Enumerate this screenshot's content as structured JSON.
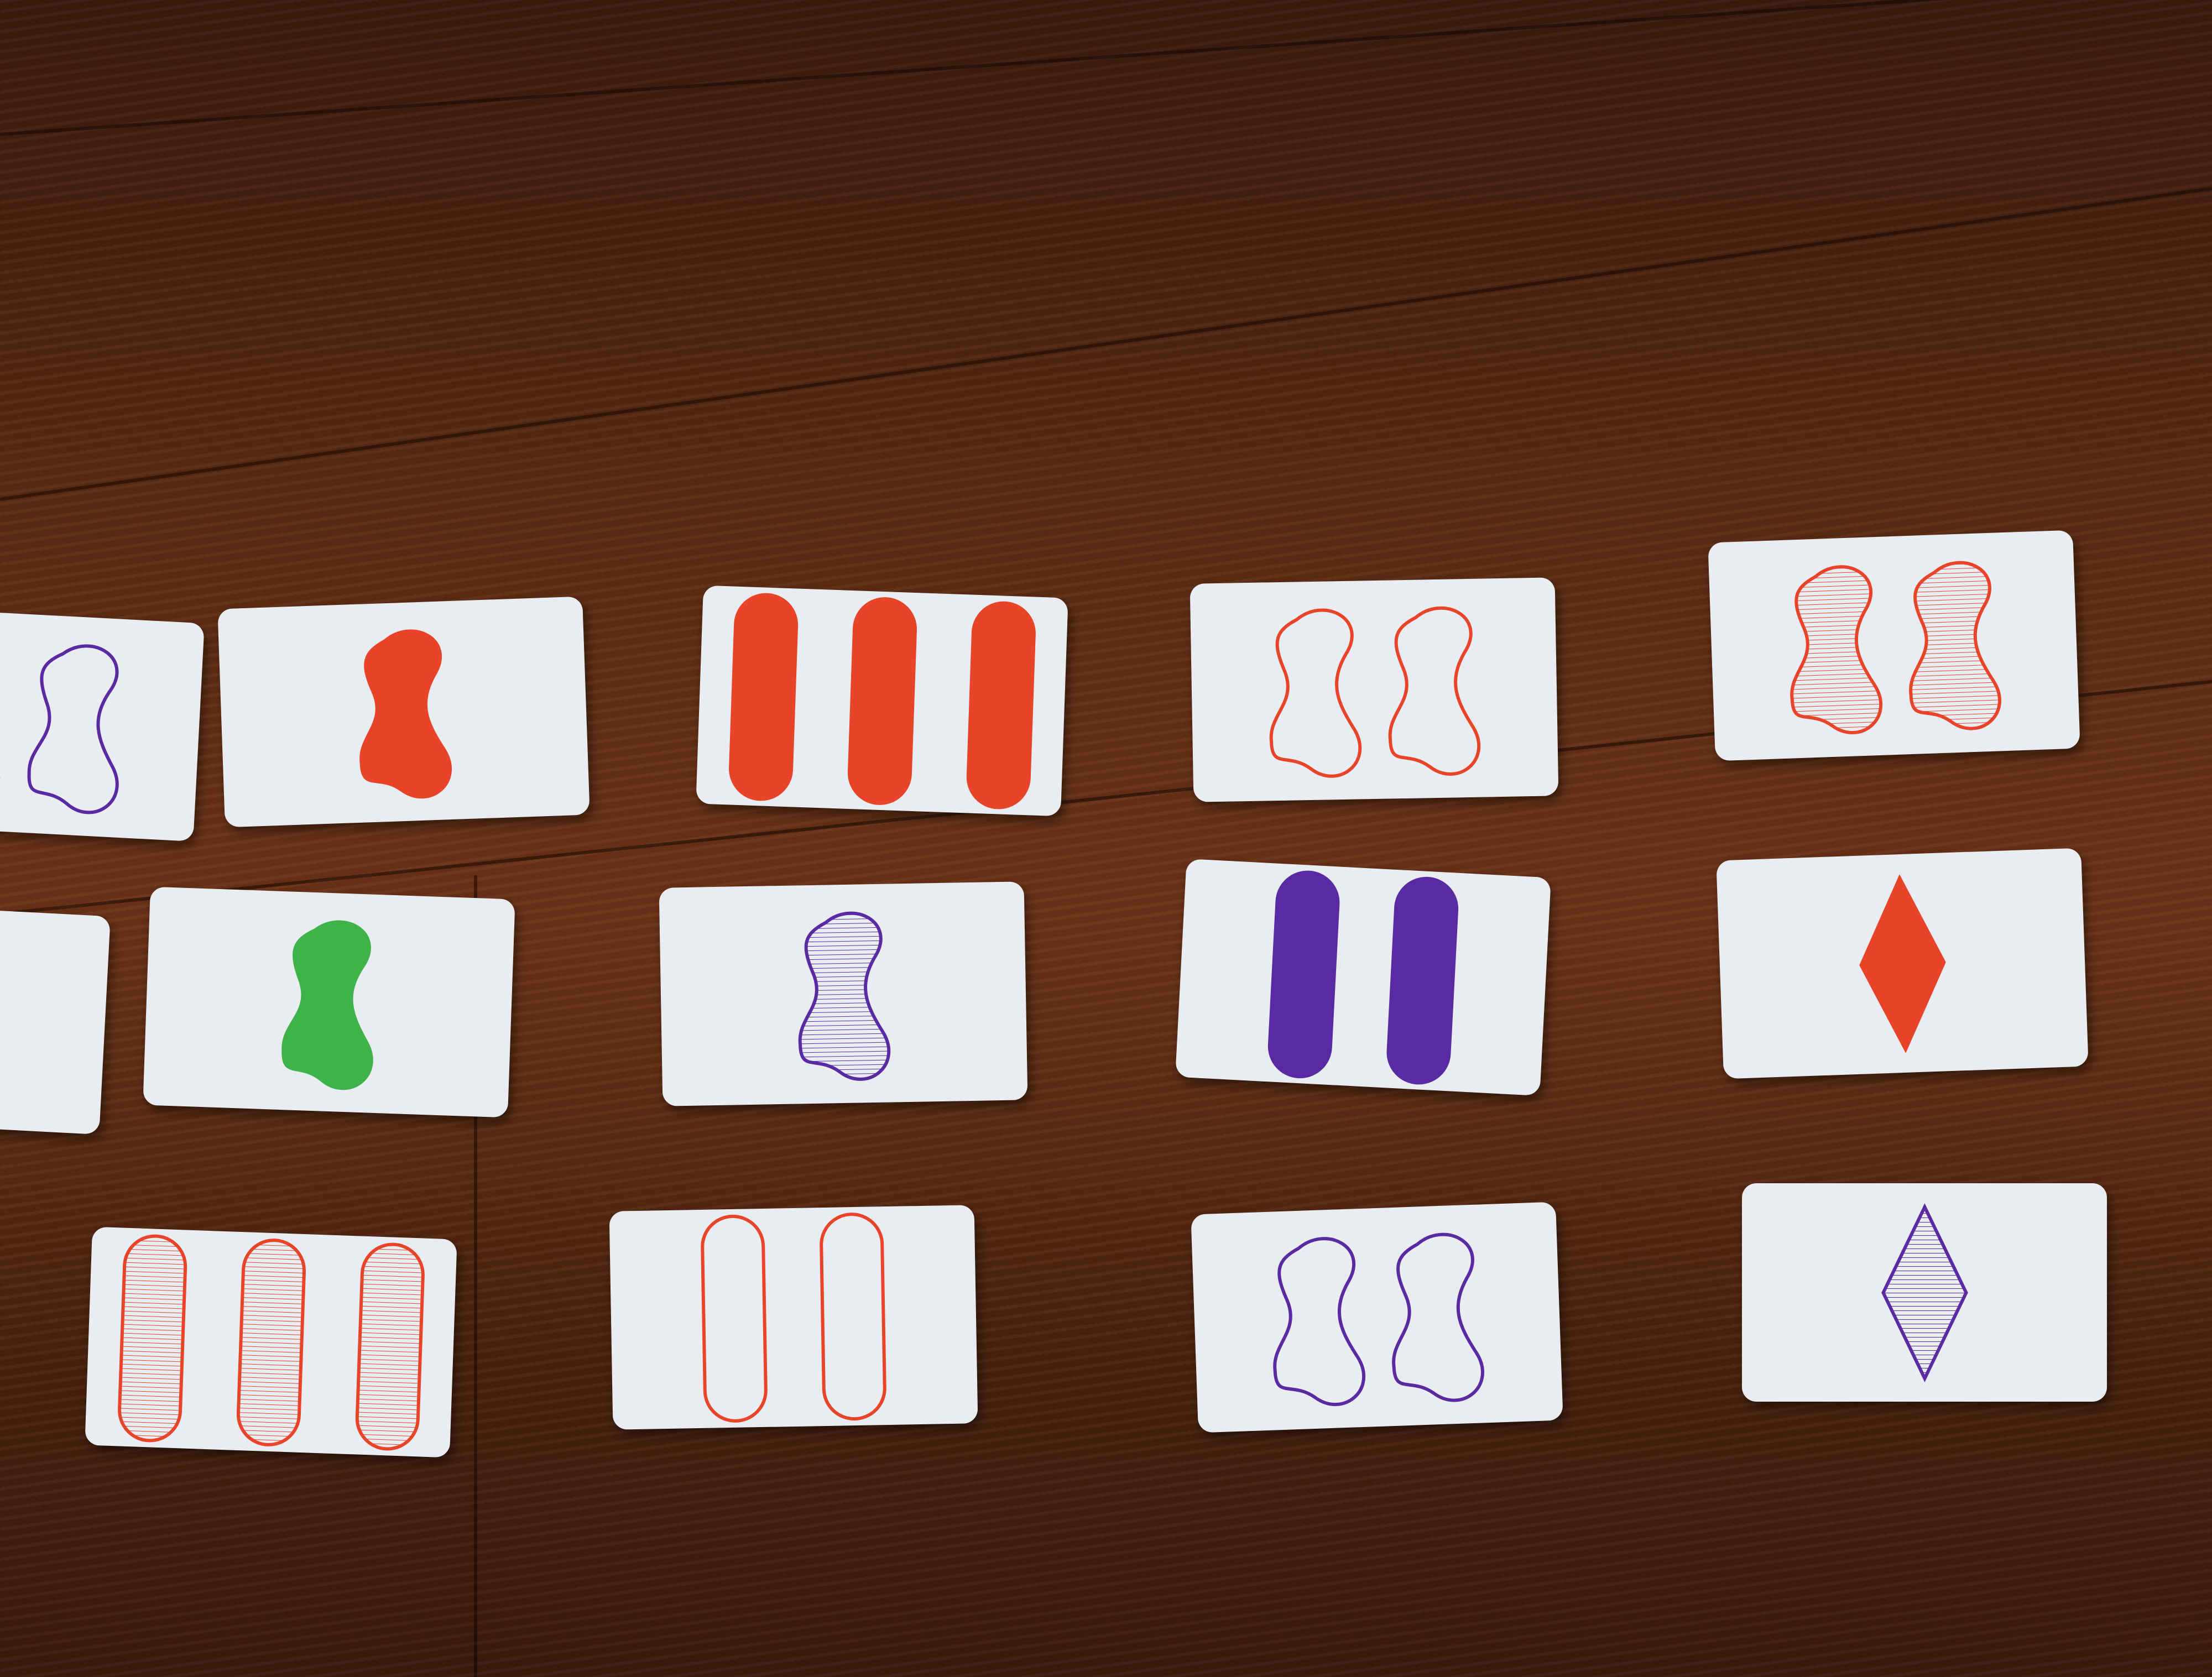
{
  "scene": {
    "description_tag": "set-game-cards-on-wood-floor"
  },
  "palette": {
    "red": "#e8442a",
    "green": "#3fb34a",
    "purple": "#5a2aa3",
    "card": "#e9ecf1",
    "wood": "#5a2a12"
  },
  "cards": [
    {
      "id": "c1",
      "count": 2,
      "shape": "squiggle",
      "color": "purple",
      "fill": "outline"
    },
    {
      "id": "c2",
      "count": 1,
      "shape": "squiggle",
      "color": "red",
      "fill": "solid"
    },
    {
      "id": "c3",
      "count": 3,
      "shape": "oval",
      "color": "red",
      "fill": "solid"
    },
    {
      "id": "c4",
      "count": 2,
      "shape": "squiggle",
      "color": "red",
      "fill": "outline"
    },
    {
      "id": "c5",
      "count": 2,
      "shape": "squiggle",
      "color": "red",
      "fill": "striped"
    },
    {
      "id": "c6",
      "count": 0,
      "shape": "none",
      "color": "none",
      "fill": "none"
    },
    {
      "id": "c7",
      "count": 1,
      "shape": "squiggle",
      "color": "green",
      "fill": "solid"
    },
    {
      "id": "c8",
      "count": 1,
      "shape": "squiggle",
      "color": "purple",
      "fill": "striped"
    },
    {
      "id": "c9",
      "count": 2,
      "shape": "oval",
      "color": "purple",
      "fill": "solid"
    },
    {
      "id": "c10",
      "count": 1,
      "shape": "diamond",
      "color": "red",
      "fill": "solid"
    },
    {
      "id": "c11",
      "count": 3,
      "shape": "oval",
      "color": "red",
      "fill": "striped"
    },
    {
      "id": "c12",
      "count": 2,
      "shape": "oval",
      "color": "red",
      "fill": "outline"
    },
    {
      "id": "c13",
      "count": 2,
      "shape": "squiggle",
      "color": "purple",
      "fill": "outline"
    },
    {
      "id": "c14",
      "count": 1,
      "shape": "diamond",
      "color": "purple",
      "fill": "striped"
    }
  ]
}
